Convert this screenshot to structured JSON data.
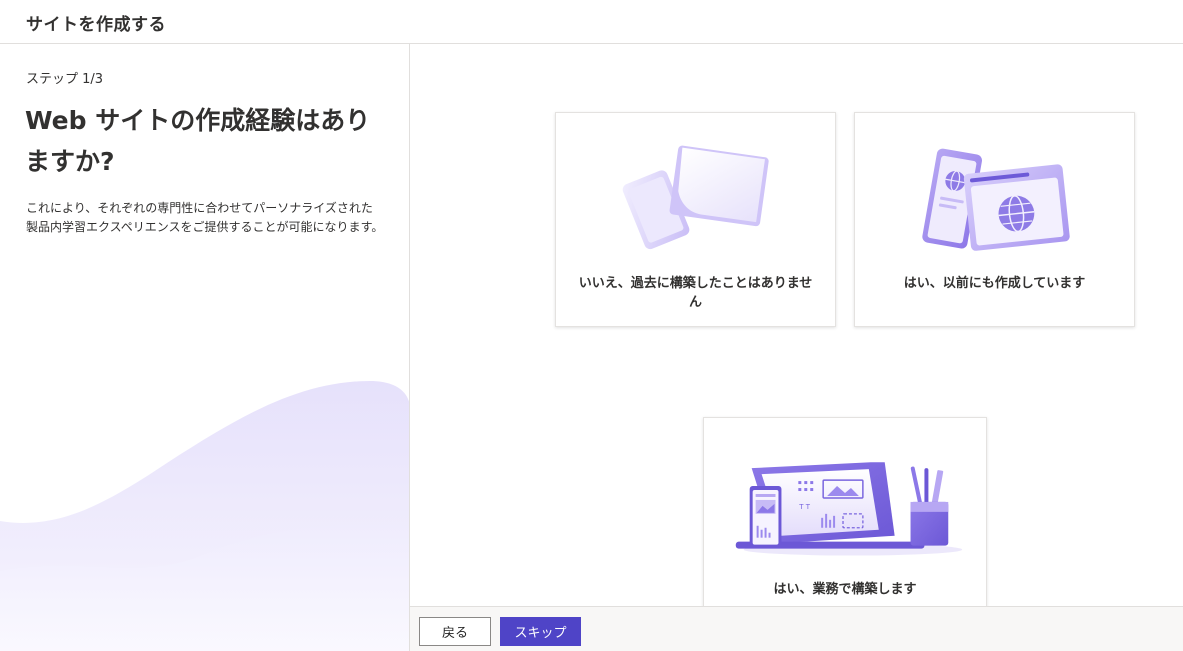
{
  "header": {
    "title": "サイトを作成する"
  },
  "left": {
    "step": "ステップ 1/3",
    "heading": "Web サイトの作成経験はありますか?",
    "description": "これにより、それぞれの専門性に合わせてパーソナライズされた製品内学習エクスペリエンスをご提供することが可能になります。"
  },
  "options": [
    {
      "label": "いいえ、過去に構築したことはありません",
      "illustration": "loose-papers-illustration"
    },
    {
      "label": "はい、以前にも作成しています",
      "illustration": "globe-pages-illustration"
    },
    {
      "label": "はい、業務で構築します",
      "illustration": "design-workspace-illustration"
    }
  ],
  "footer": {
    "back_label": "戻る",
    "skip_label": "スキップ"
  },
  "colors": {
    "accent": "#4f44c7",
    "illustration_purple": "#a08cf0"
  }
}
